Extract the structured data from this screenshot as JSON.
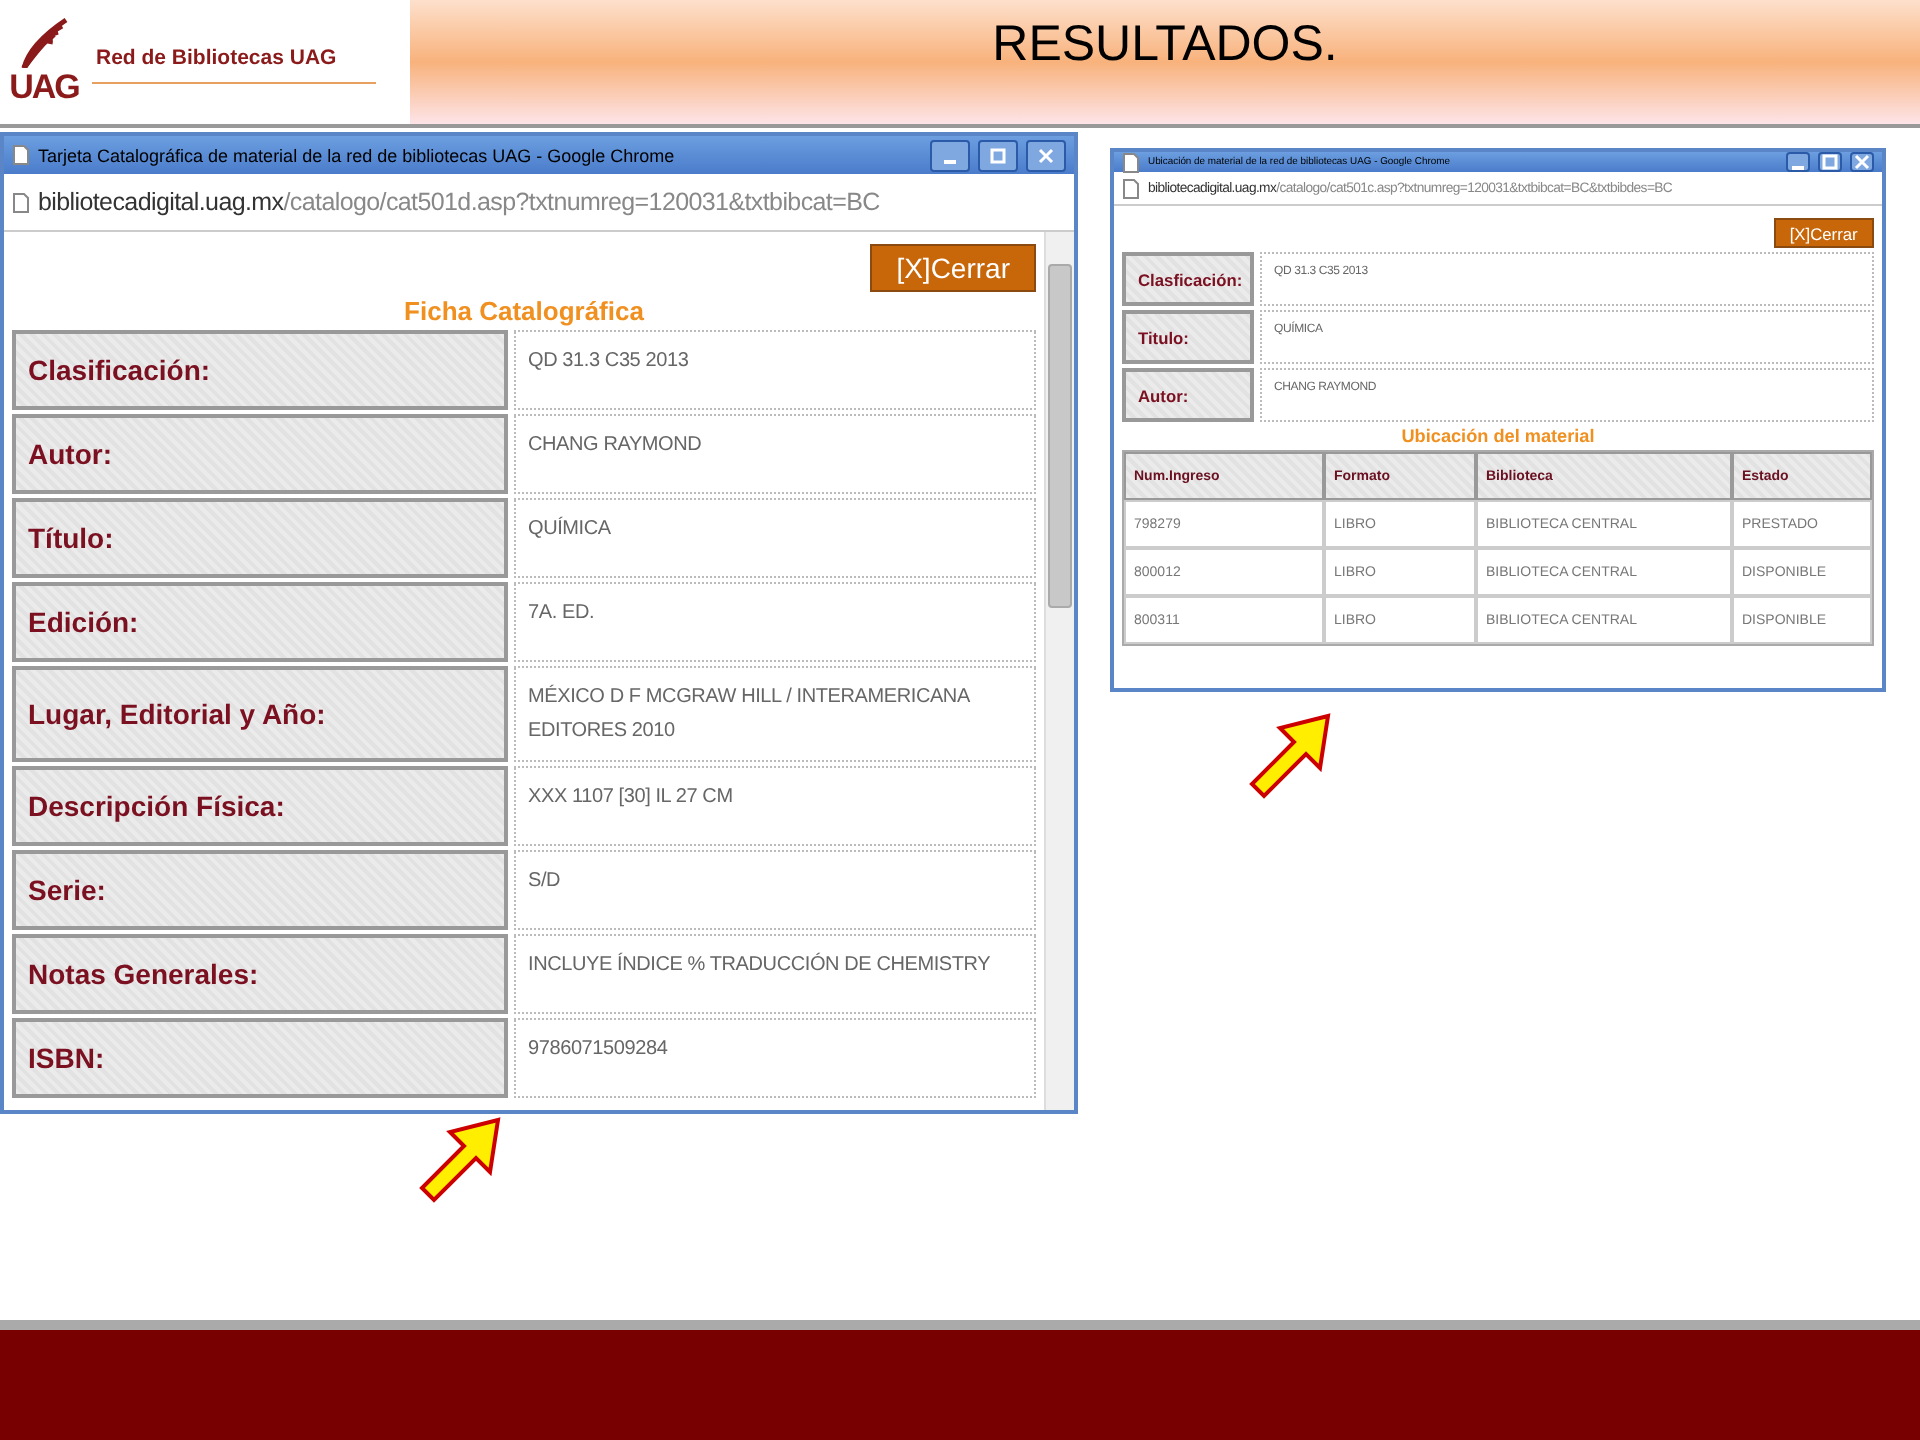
{
  "header": {
    "logo_text": "UAG",
    "brand": "Red de Bibliotecas UAG",
    "title": "RESULTADOS."
  },
  "catalog_window": {
    "title": "Tarjeta Catalográfica de material de la red de bibliotecas UAG - Google Chrome",
    "url_host": "bibliotecadigital.uag.mx",
    "url_path": "/catalogo/cat501d.asp?txtnumreg=120031&txtbibcat=BC",
    "close_button": "[X]Cerrar",
    "heading": "Ficha Catalográfica",
    "fields": [
      {
        "label": "Clasificación:",
        "value": "QD 31.3 C35 2013"
      },
      {
        "label": "Autor:",
        "value": "CHANG RAYMOND"
      },
      {
        "label": "Título:",
        "value": "QUÍMICA"
      },
      {
        "label": "Edición:",
        "value": "7A. ED."
      },
      {
        "label": "Lugar, Editorial y Año:",
        "value": "MÉXICO D F MCGRAW HILL / INTERAMERICANA EDITORES 2010"
      },
      {
        "label": "Descripción Física:",
        "value": "XXX 1107 [30] IL 27 CM"
      },
      {
        "label": "Serie:",
        "value": "S/D"
      },
      {
        "label": "Notas Generales:",
        "value": "INCLUYE ÍNDICE % TRADUCCIÓN DE CHEMISTRY"
      },
      {
        "label": "ISBN:",
        "value": "9786071509284"
      }
    ]
  },
  "location_window": {
    "title": "Ubicación de material de la red de bibliotecas UAG - Google Chrome",
    "url_host": "bibliotecadigital.uag.mx",
    "url_path": "/catalogo/cat501c.asp?txtnumreg=120031&txtbibcat=BC&txtbibdes=BC",
    "close_button": "[X]Cerrar",
    "fields": [
      {
        "label": "Clasficación:",
        "value": "QD 31.3 C35 2013"
      },
      {
        "label": "Titulo:",
        "value": "QUÍMICA"
      },
      {
        "label": "Autor:",
        "value": "CHANG RAYMOND"
      }
    ],
    "heading": "Ubicación del material",
    "table": {
      "columns": [
        "Num.Ingreso",
        "Formato",
        "Biblioteca",
        "Estado"
      ],
      "rows": [
        [
          "798279",
          "LIBRO",
          "BIBLIOTECA CENTRAL",
          "PRESTADO"
        ],
        [
          "800012",
          "LIBRO",
          "BIBLIOTECA CENTRAL",
          "DISPONIBLE"
        ],
        [
          "800311",
          "LIBRO",
          "BIBLIOTECA CENTRAL",
          "DISPONIBLE"
        ]
      ]
    }
  }
}
